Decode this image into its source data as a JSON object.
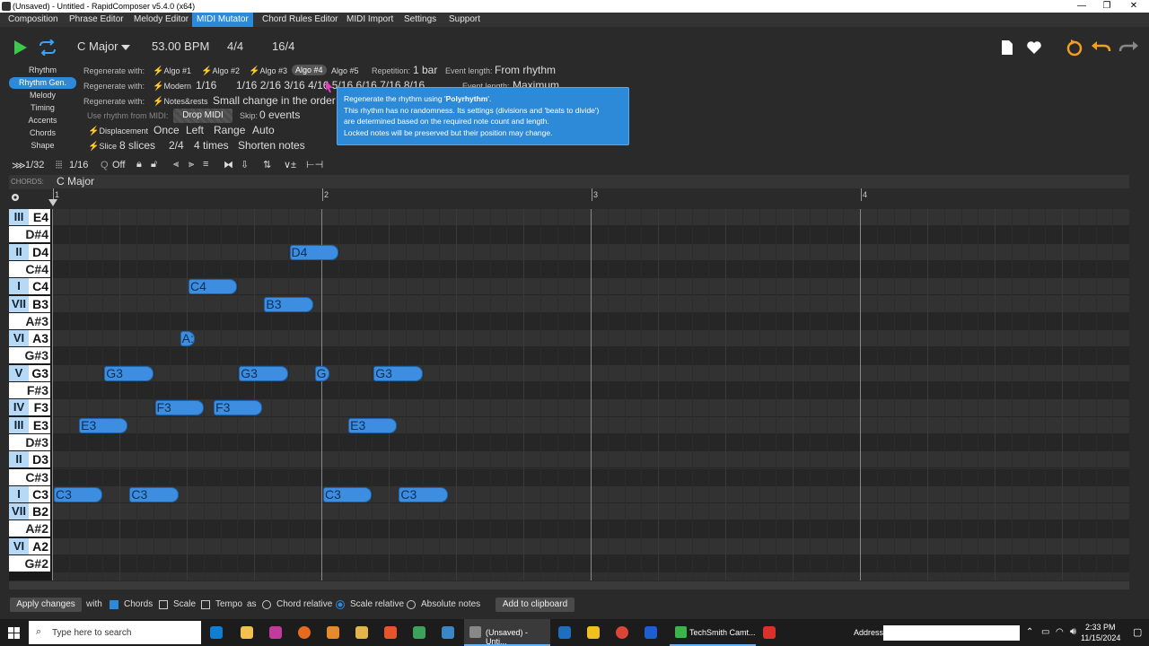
{
  "window": {
    "title": "(Unsaved) - Untitled - RapidComposer v5.4.0 (x64)",
    "minimize": "—",
    "maximize": "❐",
    "close": "✕"
  },
  "menu": [
    "Composition",
    "Phrase Editor",
    "Melody Editor",
    "MIDI Mutator",
    "Chord Rules Editor",
    "MIDI Import",
    "Settings",
    "Support"
  ],
  "transport": {
    "key": "C Major",
    "tempo": "53.00 BPM",
    "meter": "4/4",
    "length": "16/4"
  },
  "sidebar": [
    "Rhythm",
    "Rhythm Gen.",
    "Melody",
    "Timing",
    "Accents",
    "Chords",
    "Shape"
  ],
  "options": {
    "regen_label": "Regenerate with:",
    "algos": [
      "Algo #1",
      "Algo #2",
      "Algo #3",
      "Algo #4",
      "Algo #5"
    ],
    "repetition_label": "Repetition:",
    "repetition_value": "1 bar",
    "event_length_label": "Event length:",
    "event_length_value": "From rhythm",
    "modern_label": "Modern",
    "modern_value": "1/16",
    "divisions": "1/16  2/16  3/16  4/16  5/16  6/16  7/16  8/16",
    "event_length2_label": "Event length:",
    "event_length2_value": "Maximum",
    "notesrests_label": "Notes&rests",
    "notesrests_value": "Small change in the order",
    "use_rhythm_label": "Use rhythm from MIDI:",
    "drop_midi": "Drop MIDI",
    "skip_label": "Skip:",
    "skip_value": "0 events",
    "displacement_label": "Displacement",
    "displacement_vals": [
      "Once",
      "Left",
      "Range",
      "Auto"
    ],
    "slice_label": "Slice",
    "slice_vals": [
      "8 slices",
      "2/4",
      "4 times",
      "Shorten notes"
    ]
  },
  "tooltip": {
    "line1_pre": "Regenerate the rhythm using '",
    "line1_bold": "Polyrhythm",
    "line1_post": "'.",
    "line2": "This rhythm has no randomness. Its settings (divisions and 'beats to divide')",
    "line3": "are determined based on the required note count and length.",
    "line4": "Locked notes will be preserved but their position may change."
  },
  "tools": {
    "grid1": "1/32",
    "grid2": "1/16",
    "q_label": "Q",
    "q_value": "Off"
  },
  "chords": {
    "label": "CHORDS:",
    "value": "C Major"
  },
  "ruler": [
    "1",
    "2",
    "3",
    "4"
  ],
  "keys": [
    {
      "deg": "III",
      "name": "E4"
    },
    {
      "deg": "",
      "name": "D#4"
    },
    {
      "deg": "II",
      "name": "D4"
    },
    {
      "deg": "",
      "name": "C#4"
    },
    {
      "deg": "I",
      "name": "C4"
    },
    {
      "deg": "VII",
      "name": "B3"
    },
    {
      "deg": "",
      "name": "A#3"
    },
    {
      "deg": "VI",
      "name": "A3"
    },
    {
      "deg": "",
      "name": "G#3"
    },
    {
      "deg": "V",
      "name": "G3"
    },
    {
      "deg": "",
      "name": "F#3"
    },
    {
      "deg": "IV",
      "name": "F3"
    },
    {
      "deg": "III",
      "name": "E3"
    },
    {
      "deg": "",
      "name": "D#3"
    },
    {
      "deg": "II",
      "name": "D3"
    },
    {
      "deg": "",
      "name": "C#3"
    },
    {
      "deg": "I",
      "name": "C3"
    },
    {
      "deg": "VII",
      "name": "B2"
    },
    {
      "deg": "",
      "name": "A#2"
    },
    {
      "deg": "VI",
      "name": "A2"
    },
    {
      "deg": "",
      "name": "G#2"
    }
  ],
  "notes": [
    {
      "label": "C3",
      "row": 16,
      "start": 0,
      "len": 0.375
    },
    {
      "label": "E3",
      "row": 12,
      "start": 0.375,
      "len": 0.375
    },
    {
      "label": "G3",
      "row": 9,
      "start": 0.75,
      "len": 0.375
    },
    {
      "label": "C3",
      "row": 16,
      "start": 1.125,
      "len": 0.375
    },
    {
      "label": "F3",
      "row": 11,
      "start": 1.5,
      "len": 0.375
    },
    {
      "label": "A:",
      "row": 7,
      "start": 1.875,
      "len": 0.125
    },
    {
      "label": "C4",
      "row": 4,
      "start": 2,
      "len": 0.375
    },
    {
      "label": "F3",
      "row": 11,
      "start": 2.375,
      "len": 0.375
    },
    {
      "label": "G3",
      "row": 9,
      "start": 2.75,
      "len": 0.375
    },
    {
      "label": "B3",
      "row": 5,
      "start": 3.125,
      "len": 0.375
    },
    {
      "label": "D4",
      "row": 2,
      "start": 3.5,
      "len": 0.375
    },
    {
      "label": "G",
      "row": 9,
      "start": 3.875,
      "len": 0.125
    },
    {
      "label": "C3",
      "row": 16,
      "start": 4,
      "len": 0.375
    },
    {
      "label": "E3",
      "row": 12,
      "start": 4.375,
      "len": 0.375
    },
    {
      "label": "G3",
      "row": 9,
      "start": 4.75,
      "len": 0.375
    },
    {
      "label": "C3",
      "row": 16,
      "start": 5.125,
      "len": 0.375
    }
  ],
  "bottom": {
    "apply": "Apply changes",
    "with": "with",
    "chords": "Chords",
    "scale": "Scale",
    "tempo": "Tempo",
    "as": "as",
    "chord_rel": "Chord relative",
    "scale_rel": "Scale relative",
    "absolute": "Absolute notes",
    "clipboard": "Add to clipboard"
  },
  "taskbar": {
    "search": "Type here to search",
    "app1": "(Unsaved) - Unti...",
    "app2": "TechSmith Camt...",
    "address": "Address",
    "time": "2:33 PM",
    "date": "11/15/2024"
  },
  "colors": {
    "accent": "#2d8ad8",
    "note": "#3d8ee0"
  }
}
